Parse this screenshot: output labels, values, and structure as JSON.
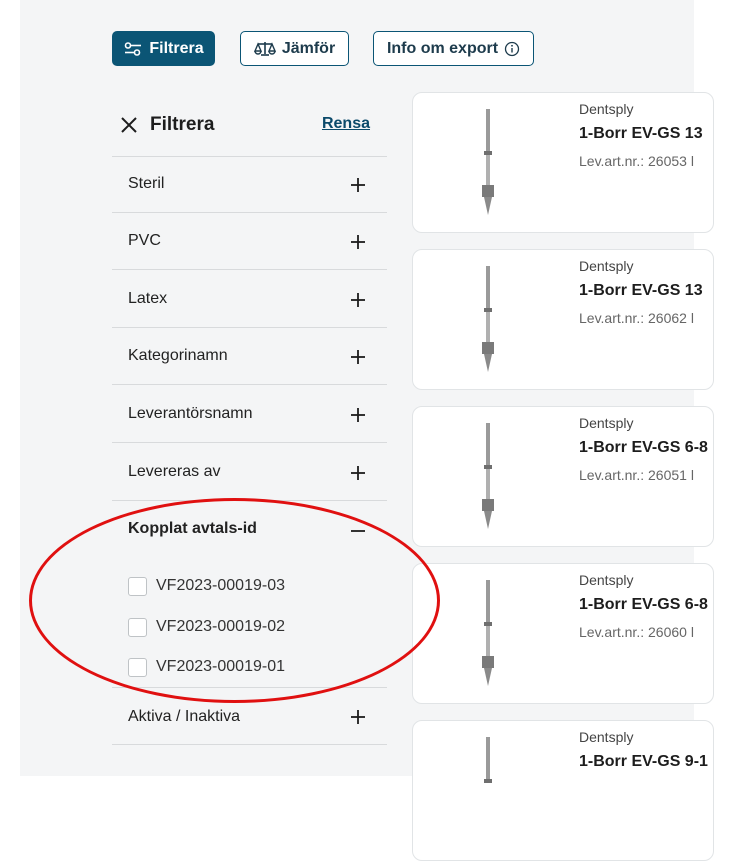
{
  "toolbar": {
    "filter_label": "Filtrera",
    "compare_label": "Jämför",
    "export_label": "Info om export"
  },
  "filter_panel": {
    "title": "Filtrera",
    "clear_label": "Rensa",
    "sections": [
      {
        "label": "Steril"
      },
      {
        "label": "PVC"
      },
      {
        "label": "Latex"
      },
      {
        "label": "Kategorinamn"
      },
      {
        "label": "Leverantörsnamn"
      },
      {
        "label": "Levereras av"
      },
      {
        "label": "Kopplat avtals-id",
        "expanded": true
      },
      {
        "label": "Aktiva / Inaktiva"
      }
    ],
    "options": [
      {
        "label": "VF2023-00019-03",
        "checked": false
      },
      {
        "label": "VF2023-00019-02",
        "checked": false
      },
      {
        "label": "VF2023-00019-01",
        "checked": false
      }
    ]
  },
  "products": [
    {
      "brand": "Dentsply",
      "name": "1-Borr EV-GS 13",
      "art": "Lev.art.nr.: 26053 l"
    },
    {
      "brand": "Dentsply",
      "name": "1-Borr EV-GS 13",
      "art": "Lev.art.nr.: 26062 l"
    },
    {
      "brand": "Dentsply",
      "name": "1-Borr EV-GS 6-8",
      "art": "Lev.art.nr.: 26051 l"
    },
    {
      "brand": "Dentsply",
      "name": "1-Borr EV-GS 6-8",
      "art": "Lev.art.nr.: 26060 l"
    },
    {
      "brand": "Dentsply",
      "name": "1-Borr EV-GS 9-1",
      "art": ""
    }
  ],
  "colors": {
    "accent": "#0b5575",
    "annotation": "#e01010",
    "background": "#f4f5f6"
  }
}
